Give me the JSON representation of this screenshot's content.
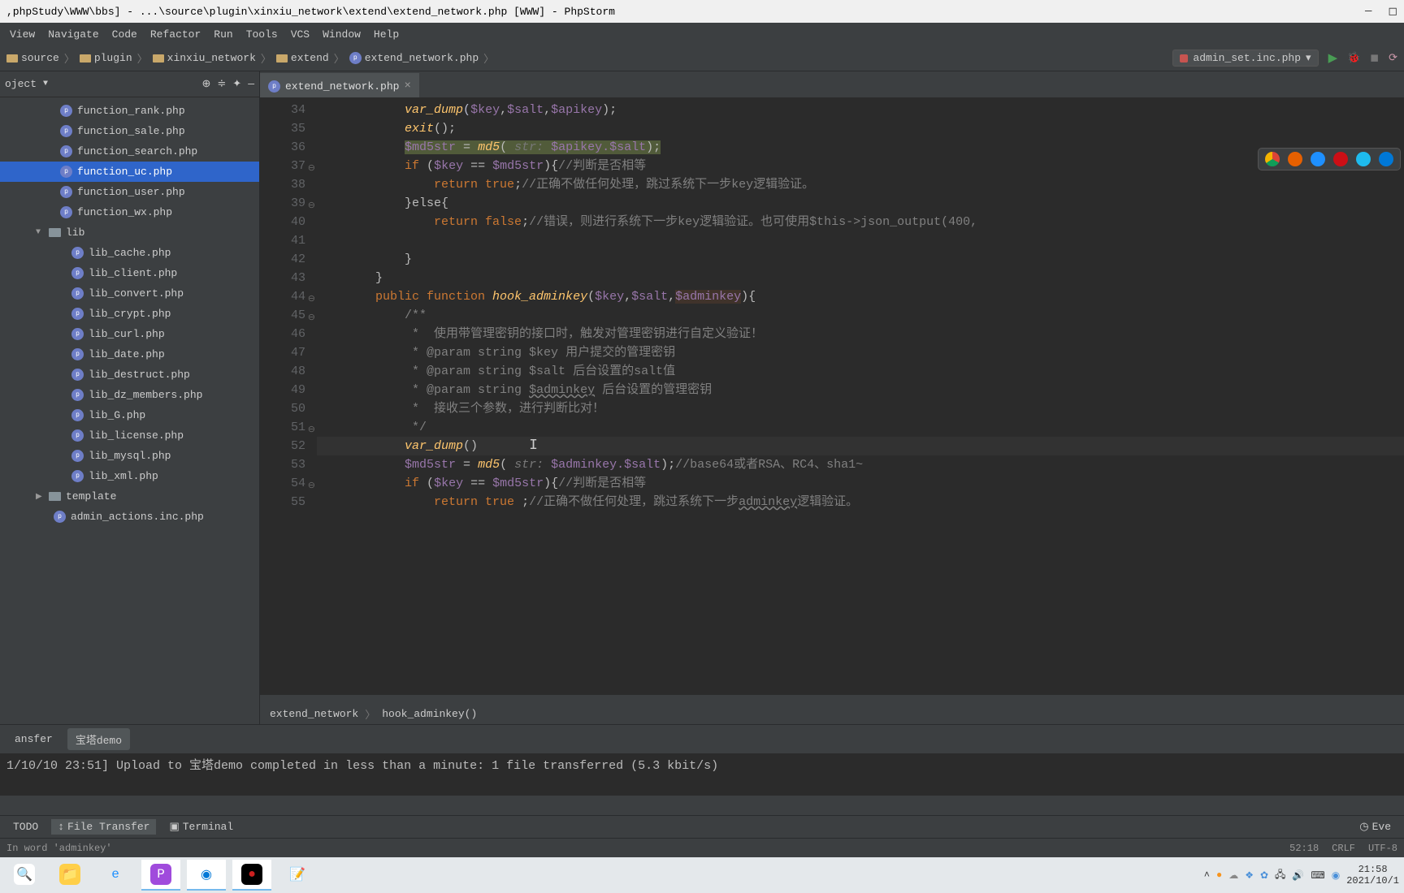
{
  "title": ",phpStudy\\WWW\\bbs] - ...\\source\\plugin\\xinxiu_network\\extend\\extend_network.php [WWW] - PhpStorm",
  "menu": [
    "View",
    "Navigate",
    "Code",
    "Refactor",
    "Run",
    "Tools",
    "VCS",
    "Window",
    "Help"
  ],
  "breadcrumb": [
    "source",
    "plugin",
    "xinxiu_network",
    "extend",
    "extend_network.php"
  ],
  "run_config": "admin_set.inc.php",
  "side_header": "oject",
  "tree": {
    "files_above": [
      "function_rank.php",
      "function_sale.php",
      "function_search.php",
      "function_uc.php",
      "function_user.php",
      "function_wx.php"
    ],
    "selected": "function_uc.php",
    "dir": "lib",
    "lib_files": [
      "lib_cache.php",
      "lib_client.php",
      "lib_convert.php",
      "lib_crypt.php",
      "lib_curl.php",
      "lib_date.php",
      "lib_destruct.php",
      "lib_dz_members.php",
      "lib_G.php",
      "lib_license.php",
      "lib_mysql.php",
      "lib_xml.php"
    ],
    "dir2": "template",
    "file_after": "admin_actions.inc.php"
  },
  "tab_name": "extend_network.php",
  "lines": {
    "start": 34,
    "l34": {
      "fn": "var_dump",
      "args": "($key,$salt,$apikey);"
    },
    "l35": {
      "fn": "exit",
      "rest": "();"
    },
    "l36": {
      "v": "$md5str",
      "op": " = ",
      "fn": "md5",
      "hint": " str: ",
      "arg": "$apikey.$salt",
      "end": ");"
    },
    "l37": {
      "kw": "if ",
      "open": "(",
      "v1": "$key",
      "op": " == ",
      "v2": "$md5str",
      "close": "){",
      "cm": "//判断是否相等"
    },
    "l38": {
      "kw": "return true",
      "end": ";",
      "cm": "//正确不做任何处理，跳过系统下一步key逻辑验证。"
    },
    "l39": "}else{",
    "l40": {
      "kw": "return false",
      "end": ";",
      "cm": "//错误，则进行系统下一步key逻辑验证。也可使用$this->json_output(400,"
    },
    "l42": "}",
    "l43": "}",
    "l44": {
      "kw1": "public function ",
      "fn": "hook_adminkey",
      "open": "(",
      "v1": "$key",
      "c1": ",",
      "v2": "$salt",
      "c2": ",",
      "v3": "$adminkey",
      "close": "){"
    },
    "l45": "/**",
    "l46": " *  使用带管理密钥的接口时，触发对管理密钥进行自定义验证！",
    "l47": " * @param string $key 用户提交的管理密钥",
    "l48": " * @param string $salt 后台设置的salt值",
    "l49_a": " * @param string ",
    "l49_v": "$adminkey",
    "l49_b": " 后台设置的管理密钥",
    "l50": " *  接收三个参数，进行判断比对！",
    "l51": " */",
    "l52": {
      "fn": "var_dump",
      "rest": "()"
    },
    "l53": {
      "v": "$md5str",
      "op": " = ",
      "fn": "md5",
      "hint": " str: ",
      "arg": "$adminkey.$salt",
      "end": ");",
      "cm": "//base64或者RSA、RC4、sha1~"
    },
    "l54": {
      "kw": "if ",
      "open": "(",
      "v1": "$key",
      "op": " == ",
      "v2": "$md5str",
      "close": "){",
      "cm": "//判断是否相等"
    },
    "l55": {
      "kw": "return true ",
      "end": ";",
      "cm1": "//正确不做任何处理，跳过系统下一步",
      "cm2": "adminkey",
      "cm3": "逻辑验证。"
    }
  },
  "editor_breadcrumb": [
    "extend_network",
    "hook_adminkey()"
  ],
  "panel_tabs": [
    "ansfer",
    "宝塔demo"
  ],
  "console_line": "1/10/10 23:51] Upload to 宝塔demo completed in less than a minute: 1 file transferred (5.3 kbit/s)",
  "tool_tabs": {
    "todo": "TODO",
    "ft": "File Transfer",
    "term": "Terminal",
    "event": "Eve"
  },
  "status_left": "In word 'adminkey'",
  "status_right": {
    "pos": "52:18",
    "crlf": "CRLF",
    "enc": "UTF-8"
  },
  "clock": {
    "time": "21:58",
    "date": "2021/10/1"
  }
}
